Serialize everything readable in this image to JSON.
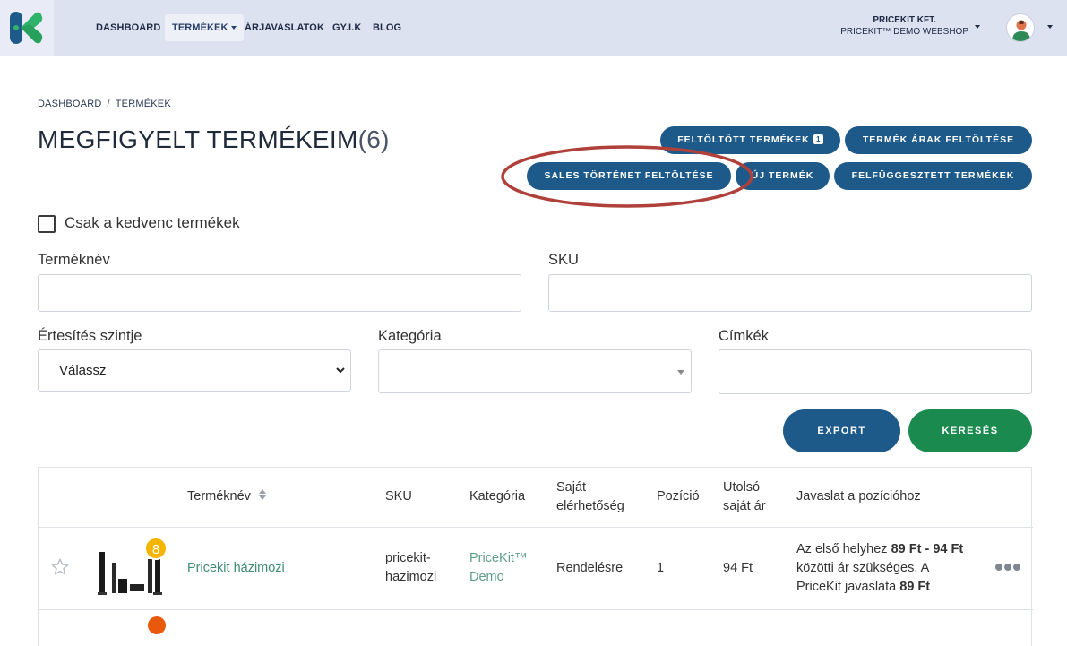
{
  "nav": {
    "items": [
      "DASHBOARD",
      "TERMÉKEK",
      "ÁRJAVASLATOK",
      "GY.I.K",
      "BLOG"
    ],
    "company_name": "PRICEKIT KFT.",
    "company_shop": "PRICEKIT™ DEMO WEBSHOP"
  },
  "breadcrumb": {
    "home": "DASHBOARD",
    "sep": "/",
    "current": "TERMÉKEK"
  },
  "title": {
    "text": "MEGFIGYELT TERMÉKEIM",
    "count": "(6)"
  },
  "actions": {
    "uploaded_products": "FELTÖLTÖTT TERMÉKEK",
    "uploaded_badge": "1",
    "upload_prices": "TERMÉK ÁRAK FELTÖLTÉSE",
    "upload_sales": "SALES TÖRTÉNET FELTÖLTÉSE",
    "new_product": "ÚJ TERMÉK",
    "suspended_products": "FELFÜGGESZTETT TERMÉKEK"
  },
  "filters": {
    "favorites_only": "Csak a kedvenc termékek",
    "product_name_label": "Terméknév",
    "sku_label": "SKU",
    "notify_level_label": "Értesítés szintje",
    "notify_level_value": "Válassz",
    "category_label": "Kategória",
    "tags_label": "Címkék"
  },
  "buttons": {
    "export": "EXPORT",
    "search": "KERESÉS"
  },
  "table": {
    "headers": {
      "name": "Terméknév",
      "sku": "SKU",
      "category": "Kategória",
      "availability_1": "Saját",
      "availability_2": "elérhetőség",
      "position": "Pozíció",
      "last_price_1": "Utolsó",
      "last_price_2": "saját ár",
      "suggestion": "Javaslat a pozícióhoz"
    },
    "rows": [
      {
        "rank": "8",
        "name": "Pricekit házimozi",
        "sku_1": "pricekit-",
        "sku_2": "hazimozi",
        "category_1": "PriceKit™",
        "category_2": "Demo",
        "availability": "Rendelésre",
        "position": "1",
        "last_price": "94 Ft",
        "suggestion_a": "Az első helyhez ",
        "suggestion_b": "89 Ft - 94 Ft",
        "suggestion_c": "közötti ár szükséges. A",
        "suggestion_d": "PriceKit javaslata ",
        "suggestion_e": "89 Ft"
      }
    ]
  },
  "colors": {
    "navbar_bg": "#dde2f1",
    "primary": "#1d5a8a",
    "success": "#1a8a4f",
    "annotation": "#b0403a",
    "rank_badge": "#f4b400"
  }
}
